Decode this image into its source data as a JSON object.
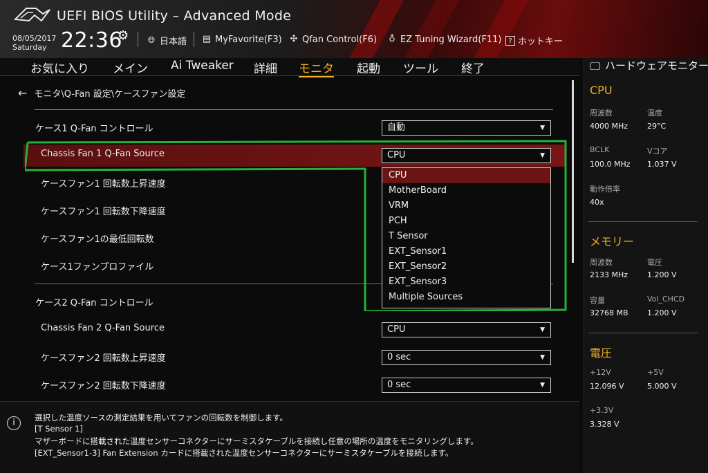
{
  "header": {
    "title": "UEFI BIOS Utility – Advanced Mode",
    "date": "08/05/2017",
    "weekday": "Saturday",
    "time": "22:36",
    "items": {
      "language": "日本語",
      "myfavorite": "MyFavorite(F3)",
      "qfan": "Qfan Control(F6)",
      "ez_tuning": "EZ Tuning Wizard(F11)",
      "hotkeys": "ホットキー"
    }
  },
  "tabs": [
    "お気に入り",
    "メイン",
    "Ai Tweaker",
    "詳細",
    "モニタ",
    "起動",
    "ツール",
    "終了"
  ],
  "active_tab": "モニタ",
  "breadcrumb": "モニタ\\Q-Fan 設定\\ケースファン設定",
  "rows": {
    "case1_control": {
      "label": "ケース1 Q-Fan コントロール",
      "value": "自動"
    },
    "chassis1_source": {
      "label": "Chassis Fan 1 Q-Fan Source",
      "value": "CPU"
    },
    "case1_up": {
      "label": "ケースファン1 回転数上昇速度"
    },
    "case1_down": {
      "label": "ケースファン1 回転数下降速度"
    },
    "case1_min": {
      "label": "ケースファン1の最低回転数"
    },
    "case1_profile": {
      "label": "ケース1ファンプロファイル"
    },
    "case2_control": {
      "label": "ケース2 Q-Fan コントロール"
    },
    "chassis2_source": {
      "label": "Chassis Fan 2 Q-Fan Source",
      "value": "CPU"
    },
    "case2_up": {
      "label": "ケースファン2 回転数上昇速度",
      "value": "0 sec"
    },
    "case2_down": {
      "label": "ケースファン2 回転数下降速度",
      "value": "0 sec"
    }
  },
  "dropdown": {
    "options": [
      "CPU",
      "MotherBoard",
      "VRM",
      "PCH",
      "T Sensor",
      "EXT_Sensor1",
      "EXT_Sensor2",
      "EXT_Sensor3",
      "Multiple Sources"
    ],
    "selected": "CPU"
  },
  "info": {
    "lines": [
      "選択した温度ソースの測定結果を用いてファンの回転数を制御します。",
      "[T Sensor 1]",
      "マザーボードに搭載された温度センサーコネクターにサーミスタケーブルを接続し任意の場所の温度をモニタリングします。",
      "[EXT_Sensor1-3] Fan Extension カードに搭載された温度センサーコネクターにサーミスタケーブルを接続します。"
    ]
  },
  "monitor": {
    "title": "ハードウェアモニター",
    "cpu": {
      "heading": "CPU",
      "freq_label": "周波数",
      "freq": "4000 MHz",
      "temp_label": "温度",
      "temp": "29°C",
      "bclk_label": "BCLK",
      "bclk": "100.0 MHz",
      "vcore_label": "Vコア",
      "vcore": "1.037 V",
      "ratio_label": "動作倍率",
      "ratio": "40x"
    },
    "memory": {
      "heading": "メモリー",
      "freq_label": "周波数",
      "freq": "2133 MHz",
      "volt_label": "電圧",
      "volt": "1.200 V",
      "cap_label": "容量",
      "cap": "32768 MB",
      "vol_chcd_label": "Vol_CHCD",
      "vol_chcd": "1.200 V"
    },
    "voltage": {
      "heading": "電圧",
      "v12_label": "+12V",
      "v12": "12.096 V",
      "v5_label": "+5V",
      "v5": "5.000 V",
      "v33_label": "+3.3V",
      "v33": "3.328 V"
    }
  },
  "colors": {
    "accent": "#f0b020",
    "highlight": "#6a1414",
    "annotation": "#22b33a"
  }
}
